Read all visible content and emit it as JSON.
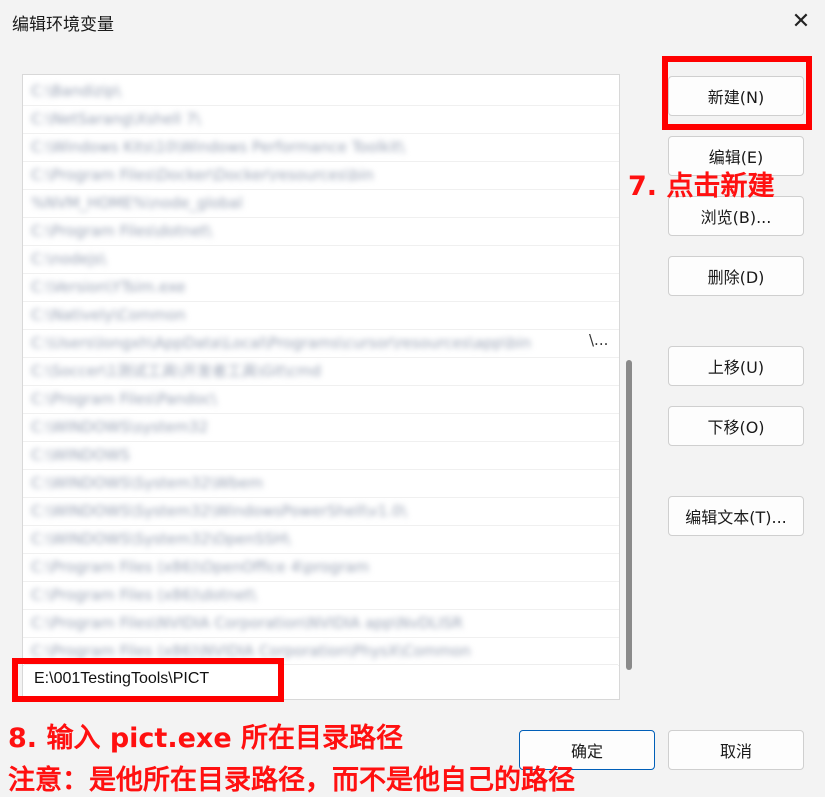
{
  "window": {
    "title": "编辑环境变量",
    "close_label": "✕"
  },
  "list": {
    "rows": [
      "C:\\Bandizip\\",
      "C:\\NetSarang\\Xshell 7\\",
      "C:\\Windows Kits\\10\\Windows Performance Toolkit\\",
      "C:\\Program Files\\Docker\\Docker\\resources\\bin",
      "%NVM_HOME%\\node_global",
      "C:\\Program Files\\dotnet\\",
      "C:\\nodejs\\",
      "C:\\Version\\YTsim.exe",
      "C:\\Natively\\Common",
      "C:\\Users\\longxh\\AppData\\Local\\Programs\\cursor\\resources\\app\\bin",
      "C:\\Soccer\\1测试工具\\开发者工具\\Git\\cmd",
      "C:\\Program Files\\Pandoc\\",
      "C:\\WINDOWS\\system32",
      "C:\\WINDOWS",
      "C:\\WINDOWS\\System32\\Wbem",
      "C:\\WINDOWS\\System32\\WindowsPowerShell\\v1.0\\",
      "C:\\WINDOWS\\System32\\OpenSSH\\",
      "C:\\Program Files (x86)\\OpenOffice 4\\program",
      "C:\\Program Files (x86)\\dotnet\\",
      "C:\\Program Files\\NVIDIA Corporation\\NVIDIA app\\NvDLISR",
      "C:\\Program Files (x86)\\NVIDIA Corporation\\PhysX\\Common"
    ],
    "row_overflow_marker": "\\...",
    "edit_value": "E:\\001TestingTools\\PICT"
  },
  "buttons": {
    "new": "新建(N)",
    "edit": "编辑(E)",
    "browse": "浏览(B)...",
    "delete": "删除(D)",
    "move_up": "上移(U)",
    "move_down": "下移(O)",
    "edit_text": "编辑文本(T)...",
    "ok": "确定",
    "cancel": "取消"
  },
  "annotations": {
    "step7": "7. 点击新建",
    "step8": "8. 输入 pict.exe 所在目录路径",
    "note": "注意：是他所在目录路径，而不是他自己的路径"
  },
  "colors": {
    "highlight": "#ff0000",
    "annotation_text": "#ff1010",
    "primary_border": "#005fb8"
  }
}
